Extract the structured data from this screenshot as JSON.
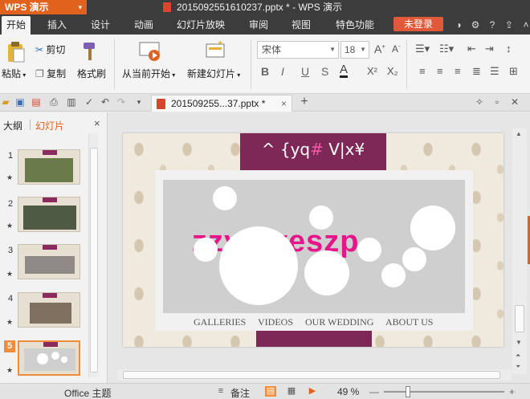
{
  "app": {
    "name": "WPS 演示",
    "caret": "▾",
    "title": "2015092551610237.pptx * - WPS 演示"
  },
  "menu": {
    "tabs": [
      "开始",
      "插入",
      "设计",
      "动画",
      "幻灯片放映",
      "审阅",
      "视图",
      "特色功能"
    ],
    "active": "开始",
    "login": "未登录"
  },
  "ribbon": {
    "paste": "粘贴",
    "cut": "剪切",
    "copy": "复制",
    "format_painter": "格式刷",
    "from_current": "从当前开始",
    "new_slide": "新建幻灯片",
    "font_name": "宋体",
    "font_size": "18",
    "bold": "B",
    "italic": "I",
    "underline": "U",
    "strike": "S",
    "color": "A",
    "superscript": "X²",
    "subscript": "X₂"
  },
  "doc_tab": {
    "label": "201509255...37.pptx *",
    "new_tab": "+"
  },
  "left_panel": {
    "tabs": [
      "大纲",
      "幻灯片"
    ],
    "active_tab": "幻灯片",
    "close": "×",
    "slides": [
      "1",
      "2",
      "3",
      "4",
      "5"
    ],
    "selected_slide": "5"
  },
  "slide": {
    "header_prefix": "^ {yq",
    "header_mark": "#",
    "header_suffix": " V|x¥",
    "brand": "zzyloveszp",
    "nav": [
      "GALLERIES",
      "VIDEOS",
      "OUR WEDDING",
      "ABOUT US"
    ]
  },
  "status": {
    "theme": "Office 主题",
    "notes": "备注",
    "zoom": "49 %",
    "zoom_level": 0.49,
    "minus": "—",
    "plus": "+"
  },
  "colors": {
    "accent": "#e0621c",
    "band": "#7d2857",
    "brand": "#e6168a",
    "titlebar": "#3c3c3c"
  }
}
